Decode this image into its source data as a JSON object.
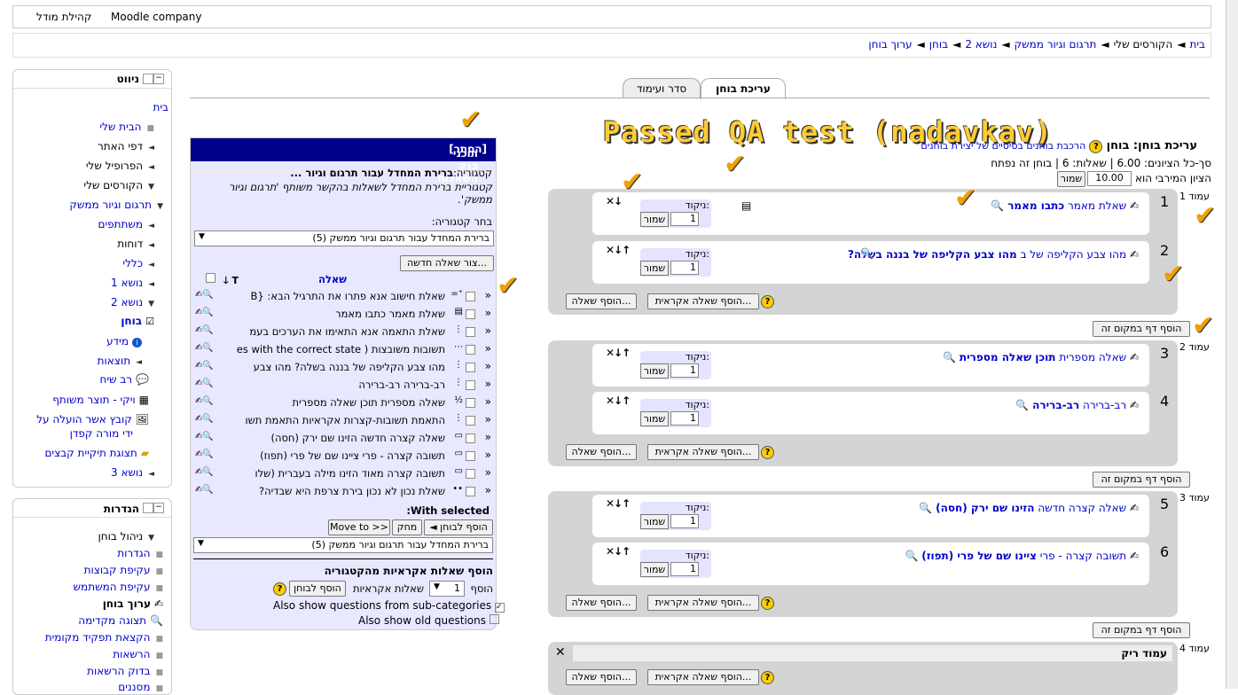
{
  "topbar": {
    "site": "קהילת מודל",
    "company": "Moodle company"
  },
  "breadcrumbs": [
    "בית",
    "הקורסים שלי",
    "תרגום וגיור ממשק",
    "נושא 2",
    "בוחן",
    "ערוך בוחן"
  ],
  "navigation": {
    "title": "ניווט",
    "items": [
      "בית",
      "הבית שלי",
      "דפי האתר",
      "הפרופיל שלי",
      "הקורסים שלי",
      "תרגום וגיור ממשק",
      "משתתפים",
      "דוחות",
      "כללי",
      "נושא 1",
      "נושא 2",
      "בוחן",
      "מידע",
      "תוצאות",
      "רב שיח",
      "ויקי - תוצר משותף",
      "קובץ אשר הועלה על",
      "ידי מורה קפדן",
      "תצוגת תיקיית קבצים",
      "נושא 3"
    ]
  },
  "settings": {
    "title": "הגדרות",
    "items": [
      "ניהול בוחן",
      "הגדרות",
      "עקיפת קבוצות",
      "עקיפת המשתמש",
      "ערוך בוחן",
      "תצוגה מקדימה",
      "הקצאת תפקיד מקומית",
      "הרשאות",
      "בדוק הרשאות",
      "מסננים"
    ]
  },
  "tabs": {
    "edit": "עריכת בוחן",
    "order": "סדר ועימוד"
  },
  "overlay": {
    "passed": "Passed QA test (nadavkav)"
  },
  "quiz": {
    "title": "עריכת בוחן: בוחן",
    "link": "הרכבת בוחנים בסיסיים של יצירת בוחנים",
    "total": "סך-כל הציונים: 6.00 | שאלות: 6 | בוחן זה נפתח",
    "maxgrade_label": "הציון המירבי הוא",
    "maxgrade_value": "10.00",
    "save": "שמור",
    "mark_label": "ניקוד:",
    "mark_value": "1",
    "add_random": "הוסף שאלה אקראית...",
    "add_question": "הוסף שאלה...",
    "add_page": "הוסף דף במקום זה",
    "empty_page": "עמוד ריק",
    "pages": [
      {
        "label": "עמוד 1",
        "questions": [
          {
            "num": "1",
            "type": "שאלת מאמר",
            "name": "כתבו מאמר"
          },
          {
            "num": "2",
            "type": "מהו צבע הקליפה של ב",
            "name": "מהו צבע הקליפה של בננה בשלה?"
          }
        ]
      },
      {
        "label": "עמוד 2",
        "questions": [
          {
            "num": "3",
            "type": "שאלה מספרית",
            "name": "תוכן שאלה מספרית"
          },
          {
            "num": "4",
            "type": "רב-ברירה",
            "name": "רב-ברירה"
          }
        ]
      },
      {
        "label": "עמוד 3",
        "questions": [
          {
            "num": "5",
            "type": "שאלה קצרה חדשה",
            "name": "הזינו שם ירק (חסה)"
          },
          {
            "num": "6",
            "type": "תשובה קצרה - פרי",
            "name": "ציינו שם של פרי (תפוז)"
          }
        ]
      },
      {
        "label": "עמוד 4"
      }
    ]
  },
  "qbank": {
    "title": "תוכני בנק השאלות",
    "hide": "[הסתר]",
    "category_label": "קטגוריה:",
    "category_name": "ברירת המחדל עבור תרגום וגיור ...",
    "category_desc": "קטגוריית ברירת המחדל לשאלות בהקשר משותף 'תרגום וגיור ממשק'.",
    "choose_category": "בחר קטגוריה:",
    "category_select": "ברירת המחדל עבור תרגום וגיור ממשק (5)",
    "new_question": "צור שאלה חדשה...",
    "col_t": "T",
    "col_question": "שאלה",
    "rows": [
      "שאלת חישוב אנא פתרו את התרגיל הבא: {B",
      "שאלת מאמר כתבו מאמר",
      "שאלת התאמה אנא התאימו את הערכים בעמ",
      "תשובות משובצות ( es with the correct state",
      "מהו צבע הקליפה של בננה בשלה? מהו צבע",
      "רב-ברירה רב-ברירה",
      "שאלה מספרית תוכן שאלה מספרית",
      "התאמת תשובות-קצרות אקראיות התאמת תשו",
      "שאלה קצרה חדשה הזינו שם ירק (חסה)",
      "תשובה קצרה - פרי ציינו שם של פרי (תפוז)",
      "תשובה קצרה מאוד הזינו מילה בעברית (שלו",
      "שאלת נכון לא נכון בירת צרפת היא שבדיה?"
    ],
    "with_selected": "With selected:",
    "add_to_quiz": "הוסף לבוחן",
    "delete": "מחק",
    "move_to": "Move to >>",
    "random_title": "הוסף שאלות אקראיות מהקטגוריה",
    "add_label": "הוסף",
    "count": "1",
    "random_suffix": "שאלות אקראיות",
    "random_button": "הוסף לבוחן",
    "subcat": "Also show questions from sub-categories",
    "oldq": "Also show old questions"
  }
}
